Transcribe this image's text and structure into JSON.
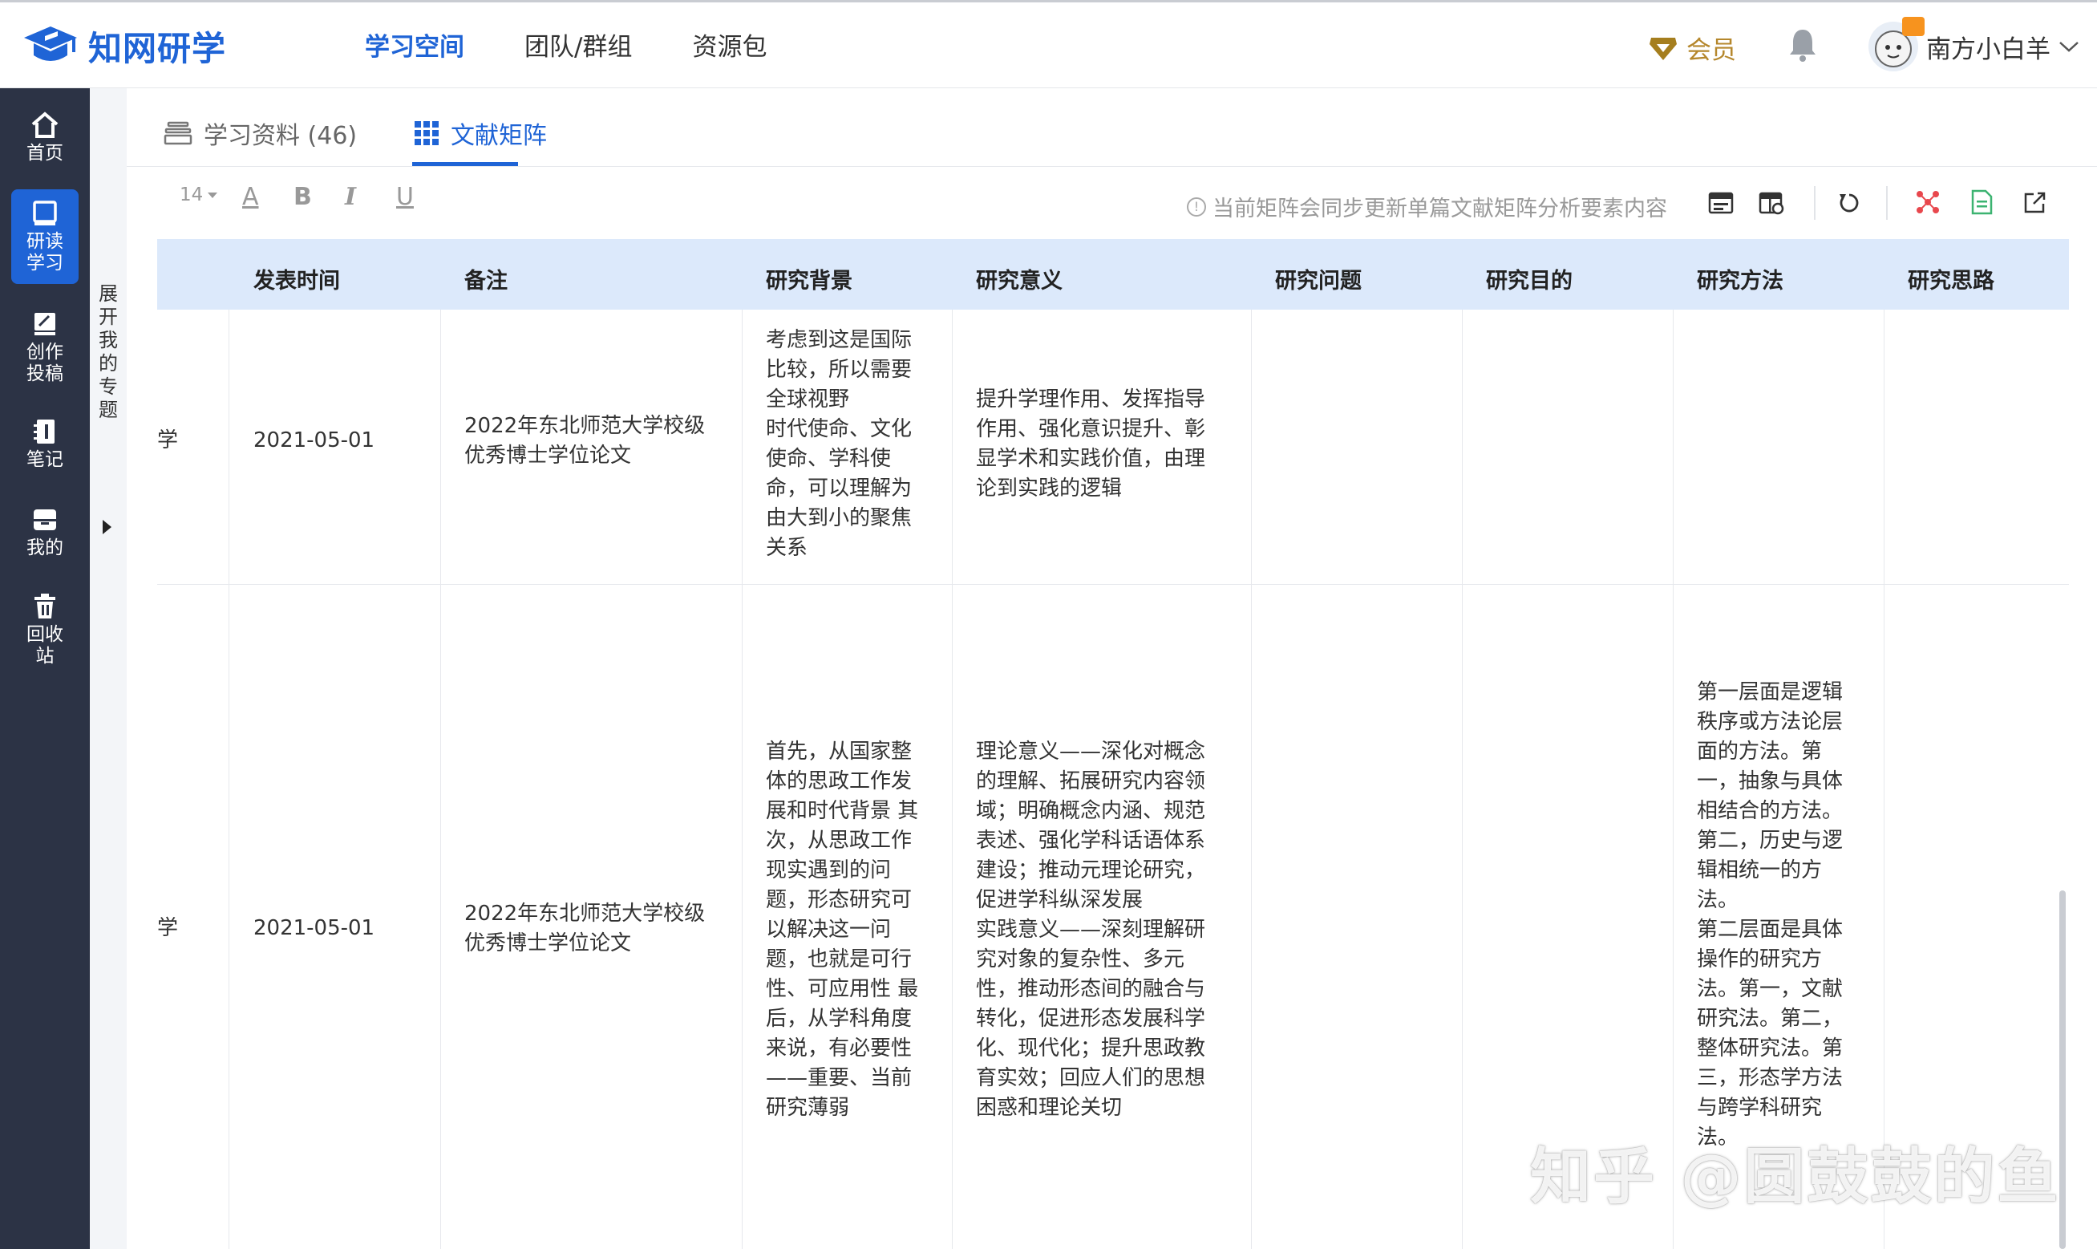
{
  "brand": {
    "name": "知网研学"
  },
  "nav": {
    "items": [
      "学习空间",
      "团队/群组",
      "资源包"
    ]
  },
  "header": {
    "vip_label": "会员",
    "username": "南方小白羊"
  },
  "sidebar": {
    "items": [
      {
        "label": "首页",
        "icon": "home-icon"
      },
      {
        "label": "研读\n学习",
        "icon": "book-icon"
      },
      {
        "label": "创作\n投稿",
        "icon": "edit-icon"
      },
      {
        "label": "笔记",
        "icon": "notebook-icon"
      },
      {
        "label": "我的",
        "icon": "box-icon"
      },
      {
        "label": "回收\n站",
        "icon": "trash-icon"
      }
    ]
  },
  "expand": {
    "label": "展开我的专题"
  },
  "tabs": [
    {
      "label": "学习资料 (46)",
      "icon": "stack-icon"
    },
    {
      "label": "文献矩阵",
      "icon": "grid-icon"
    }
  ],
  "toolbar": {
    "font_size": "14",
    "format_buttons": [
      "A",
      "B",
      "I",
      "U"
    ],
    "notice": "当前矩阵会同步更新单篇文献矩阵分析要素内容"
  },
  "table": {
    "columns": [
      "发表时间",
      "备注",
      "研究背景",
      "研究意义",
      "研究问题",
      "研究目的",
      "研究方法",
      "研究思路"
    ],
    "rows": [
      {
        "prefix": "学",
        "date": "2021-05-01",
        "note": "2022年东北师范大学校级\n优秀博士学位论文",
        "background": "考虑到这是国际\n比较，所以需要\n全球视野\n时代使命、文化\n使命、学科使\n命，可以理解为\n由大到小的聚焦\n关系",
        "significance": "提升学理作用、发挥指导\n作用、强化意识提升、彰\n显学术和实践价值，由理\n论到实践的逻辑",
        "question": "",
        "purpose": "",
        "method": "",
        "approach": ""
      },
      {
        "prefix": "学",
        "date": "2021-05-01",
        "note": "2022年东北师范大学校级\n优秀博士学位论文",
        "background": "首先，从国家整\n体的思政工作发\n展和时代背景 其\n次，从思政工作\n现实遇到的问\n题，形态研究可\n以解决这一问\n题，也就是可行\n性、可应用性 最\n后，从学科角度\n来说，有必要性\n——重要、当前\n研究薄弱",
        "significance": "理论意义——深化对概念\n的理解、拓展研究内容领\n域；明确概念内涵、规范\n表述、强化学科话语体系\n建设；推动元理论研究，\n促进学科纵深发展\n实践意义——深刻理解研\n究对象的复杂性、多元\n性，推动形态间的融合与\n转化，促进形态发展科学\n化、现代化；提升思政教\n育实效；回应人们的思想\n困惑和理论关切",
        "question": "",
        "purpose": "",
        "method": "第一层面是逻辑\n秩序或方法论层\n面的方法。第\n一，抽象与具体\n相结合的方法。\n第二，历史与逻\n辑相统一的方\n法。\n第二层面是具体\n操作的研究方\n法。第一，文献\n研究法。第二，\n整体研究法。第\n三，形态学方法\n与跨学科研究\n法。",
        "approach": ""
      }
    ]
  },
  "watermark": "知乎 @圆鼓鼓的鱼",
  "colors": {
    "accent": "#1f64d6",
    "sidebar": "#2c3345",
    "header_row": "#dce9fb",
    "vip": "#b5872c"
  }
}
